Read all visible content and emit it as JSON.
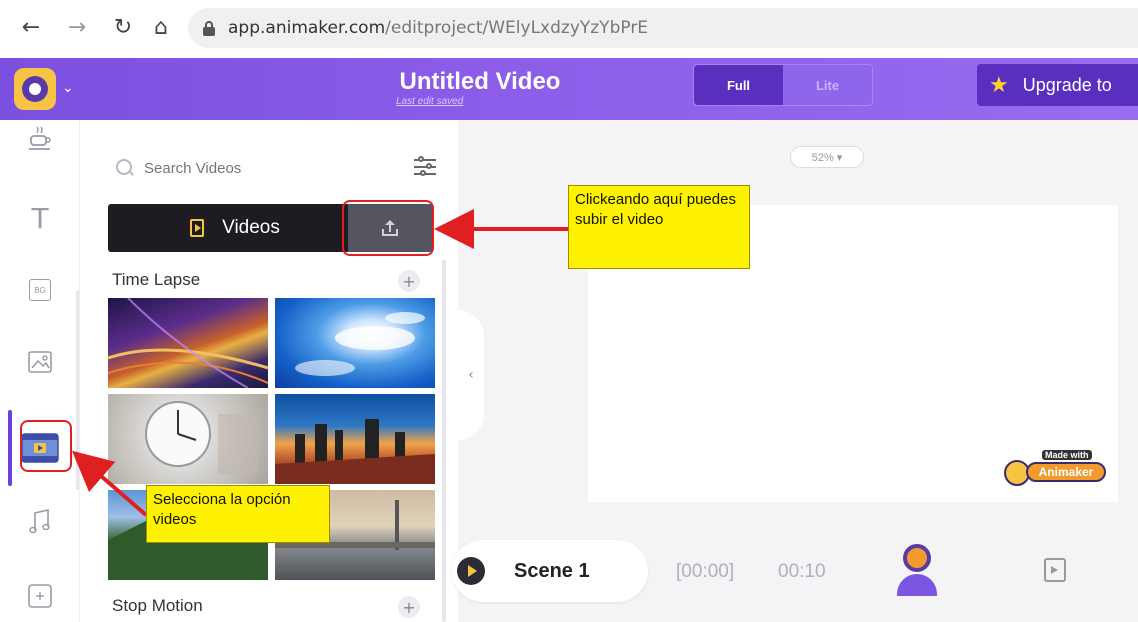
{
  "browser": {
    "url_host": "app.animaker.com",
    "url_path": "/editproject/WElyLxdzyYzYbPrE"
  },
  "header": {
    "title": "Untitled Video",
    "last_saved": "Last edit saved",
    "mode_full": "Full",
    "mode_lite": "Lite",
    "upgrade_label": "Upgrade to"
  },
  "sidebar": {
    "items": [
      {
        "icon": "coffee-cup-icon"
      },
      {
        "icon": "text-icon",
        "glyph": "T"
      },
      {
        "icon": "background-icon",
        "glyph": "BG"
      },
      {
        "icon": "image-icon"
      },
      {
        "icon": "video-icon",
        "active": true
      },
      {
        "icon": "music-note-icon"
      },
      {
        "icon": "effects-icon"
      }
    ]
  },
  "panel": {
    "search_placeholder": "Search Videos",
    "tab_videos": "Videos",
    "section1": "Time Lapse",
    "section2": "Stop Motion",
    "add_symbol": "+"
  },
  "canvas": {
    "zoom": "52% ▾",
    "watermark_small": "Made with",
    "watermark_brand": "Animaker"
  },
  "timeline": {
    "scene_label": "Scene 1",
    "time_start": "[00:00]",
    "time_end": "00:10"
  },
  "annotations": {
    "callout_upload": "Clickeando aquí puedes subir el video",
    "callout_videos": "Selecciona la opción videos"
  },
  "colors": {
    "brand_purple": "#7b4fdf",
    "accent_yellow": "#f6c343",
    "annotation_red": "#e02020",
    "callout_yellow": "#fff200"
  }
}
